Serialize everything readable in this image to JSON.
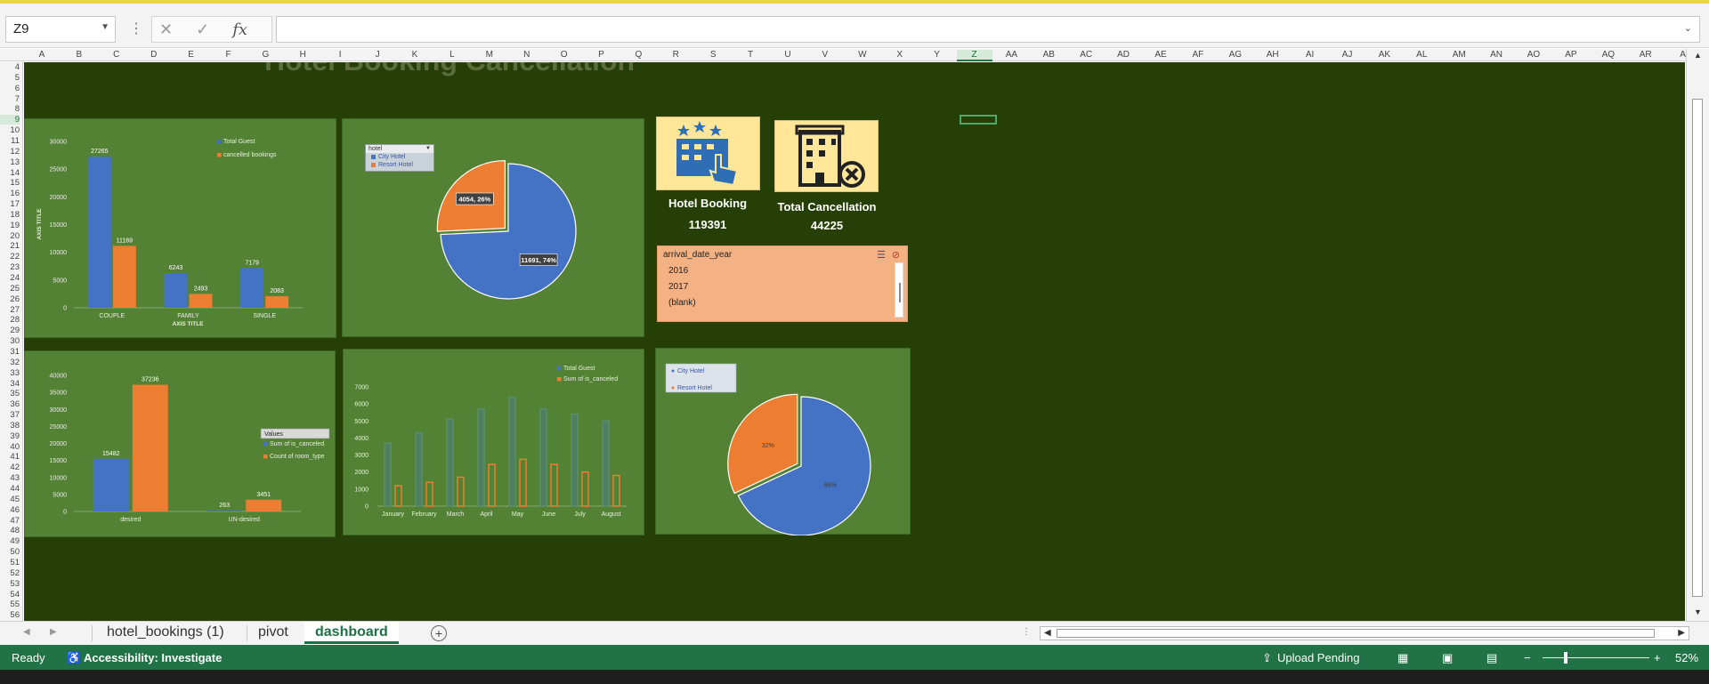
{
  "app": {
    "name_box": "Z9",
    "formula_value": ""
  },
  "columns": [
    "A",
    "B",
    "C",
    "D",
    "E",
    "F",
    "G",
    "H",
    "I",
    "J",
    "K",
    "L",
    "M",
    "N",
    "O",
    "P",
    "Q",
    "R",
    "S",
    "T",
    "U",
    "V",
    "W",
    "X",
    "Y",
    "Z",
    "AA",
    "AB",
    "AC",
    "AD",
    "AE",
    "AF",
    "AG",
    "AH",
    "AI",
    "AJ",
    "AK",
    "AL",
    "AM",
    "AN",
    "AO",
    "AP",
    "AQ",
    "AR",
    "A"
  ],
  "selected_column": "Z",
  "rows": [
    "4",
    "5",
    "6",
    "7",
    "8",
    "9",
    "10",
    "11",
    "12",
    "13",
    "14",
    "15",
    "16",
    "17",
    "18",
    "19",
    "20",
    "21",
    "22",
    "23",
    "24",
    "25",
    "26",
    "27",
    "28",
    "29",
    "30",
    "31",
    "32",
    "33",
    "34",
    "35",
    "36",
    "37",
    "38",
    "39",
    "40",
    "41",
    "42",
    "43",
    "44",
    "45",
    "46",
    "47",
    "48",
    "49",
    "50",
    "51",
    "52",
    "53",
    "54",
    "55",
    "56"
  ],
  "selected_row": "9",
  "dashboard": {
    "title": "Hotel Booking Cancellation",
    "hotel_booking": {
      "label": "Hotel Booking",
      "value": "119391"
    },
    "total_cancellation": {
      "label": "Total Cancellation",
      "value": "44225"
    },
    "year_slicer": {
      "title": "arrival_date_year",
      "items": [
        "2016",
        "2017",
        "(blank)"
      ]
    },
    "pie_slicer": {
      "title": "hotel",
      "items": [
        "City Hotel",
        "Resort Hotel"
      ]
    }
  },
  "colors": {
    "blue": "#4472c4",
    "orange": "#ed7d31",
    "panel": "#548235",
    "sheet": "#263f06",
    "excel_green": "#217346"
  },
  "chart_data": [
    {
      "type": "bar",
      "categories": [
        "COUPLE",
        "FAMILY",
        "SINGLE"
      ],
      "series": [
        {
          "name": "Total Guest",
          "values": [
            27265,
            6243,
            7179
          ]
        },
        {
          "name": "cancelled bookings",
          "values": [
            11169,
            2493,
            2083
          ]
        }
      ],
      "xlabel": "AXIS TITLE",
      "ylabel": "AXIS TITLE",
      "ylim": [
        0,
        30000
      ],
      "yticks": [
        "0",
        "5000",
        "10000",
        "15000",
        "20000",
        "25000",
        "30000"
      ],
      "legend": "top-right"
    },
    {
      "type": "pie",
      "labels": [
        "City Hotel",
        "Resort Hotel"
      ],
      "values": [
        11691,
        4054
      ],
      "data_labels": [
        "11691, 74%",
        "4054, 26%"
      ]
    },
    {
      "type": "bar",
      "categories": [
        "desired",
        "UN-desired"
      ],
      "series": [
        {
          "name": "Sum of is_canceled",
          "values": [
            15482,
            263
          ]
        },
        {
          "name": "Count of room_type",
          "values": [
            37236,
            3451
          ]
        }
      ],
      "legend_title": "Values",
      "ylim": [
        0,
        40000
      ],
      "yticks": [
        "0",
        "5000",
        "10000",
        "15000",
        "20000",
        "25000",
        "30000",
        "35000",
        "40000"
      ],
      "legend": "right"
    },
    {
      "type": "bar",
      "categories": [
        "January",
        "February",
        "March",
        "April",
        "May",
        "June",
        "July",
        "August"
      ],
      "series": [
        {
          "name": "Total Guest",
          "values": [
            3700,
            4300,
            5100,
            5700,
            6400,
            5700,
            5400,
            5000
          ]
        },
        {
          "name": "Sum of is_canceled",
          "values": [
            1200,
            1400,
            1700,
            2450,
            2750,
            2450,
            2000,
            1800
          ]
        }
      ],
      "ylim": [
        0,
        7000
      ],
      "yticks": [
        "0",
        "1000",
        "2000",
        "3000",
        "4000",
        "5000",
        "6000",
        "7000"
      ],
      "legend": "top-right"
    },
    {
      "type": "pie",
      "labels": [
        "City Hotel",
        "Resort Hotel"
      ],
      "values": [
        68,
        32
      ],
      "data_labels": [
        "68%",
        "32%"
      ],
      "legend": "top-left"
    }
  ],
  "tabs": [
    "hotel_bookings (1)",
    "pivot",
    "dashboard"
  ],
  "active_tab": "dashboard",
  "status": {
    "ready": "Ready",
    "accessibility": "Accessibility: Investigate",
    "upload": "Upload Pending",
    "zoom": "52%"
  }
}
